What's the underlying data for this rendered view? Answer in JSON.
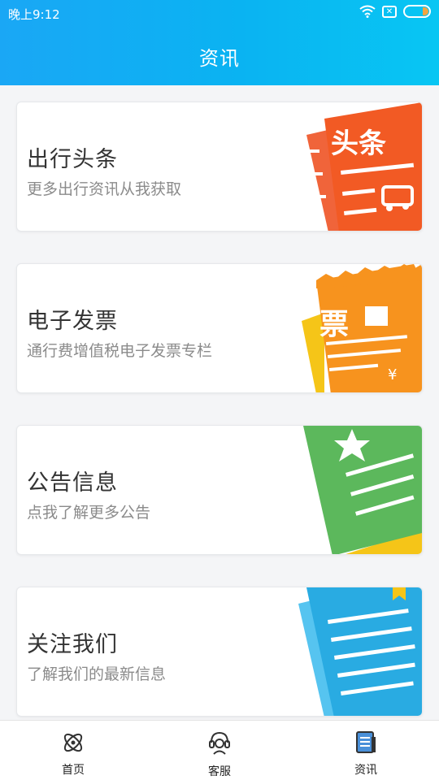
{
  "status_bar": {
    "time": "晚上9:12",
    "sim_label": "✕"
  },
  "header": {
    "title": "资讯"
  },
  "cards": [
    {
      "title": "出行头条",
      "subtitle": "更多出行资讯从我获取",
      "art_text": "头条",
      "icon": "headline-newspaper-icon"
    },
    {
      "title": "电子发票",
      "subtitle": "通行费增值税电子发票专栏",
      "art_text": "票",
      "icon": "invoice-ticket-icon"
    },
    {
      "title": "公告信息",
      "subtitle": "点我了解更多公告",
      "icon": "announcement-document-icon"
    },
    {
      "title": "关注我们",
      "subtitle": "了解我们的最新信息",
      "icon": "follow-us-notebook-icon"
    }
  ],
  "bottom_nav": {
    "items": [
      {
        "label": "首页",
        "icon": "home-atom-icon"
      },
      {
        "label": "客服",
        "icon": "customer-service-headset-icon"
      },
      {
        "label": "资讯",
        "icon": "news-document-icon"
      }
    ]
  },
  "colors": {
    "header_start": "#1aa7f5",
    "header_end": "#08c6f3",
    "headline_red": "#f15a24",
    "invoice_orange": "#f7931e",
    "notice_green": "#5cb85c",
    "follow_blue": "#29abe2"
  }
}
